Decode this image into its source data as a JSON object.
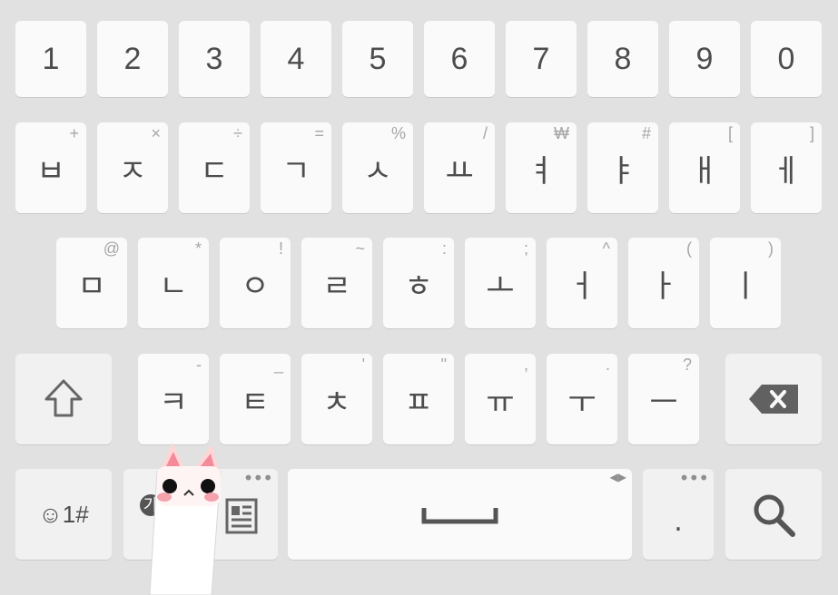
{
  "keyboard": {
    "number_row": [
      "1",
      "2",
      "3",
      "4",
      "5",
      "6",
      "7",
      "8",
      "9",
      "0"
    ],
    "row1": [
      {
        "label": "ㅂ",
        "hint": "+"
      },
      {
        "label": "ㅈ",
        "hint": "×"
      },
      {
        "label": "ㄷ",
        "hint": "÷"
      },
      {
        "label": "ㄱ",
        "hint": "="
      },
      {
        "label": "ㅅ",
        "hint": "%"
      },
      {
        "label": "ㅛ",
        "hint": "/"
      },
      {
        "label": "ㅕ",
        "hint": "₩"
      },
      {
        "label": "ㅑ",
        "hint": "#"
      },
      {
        "label": "ㅐ",
        "hint": "["
      },
      {
        "label": "ㅔ",
        "hint": "]"
      }
    ],
    "row2": [
      {
        "label": "ㅁ",
        "hint": "@"
      },
      {
        "label": "ㄴ",
        "hint": "*"
      },
      {
        "label": "ㅇ",
        "hint": "!"
      },
      {
        "label": "ㄹ",
        "hint": "~"
      },
      {
        "label": "ㅎ",
        "hint": ":"
      },
      {
        "label": "ㅗ",
        "hint": ";"
      },
      {
        "label": "ㅓ",
        "hint": "^"
      },
      {
        "label": "ㅏ",
        "hint": "("
      },
      {
        "label": "ㅣ",
        "hint": ")"
      }
    ],
    "row3": [
      {
        "label": "ㅋ",
        "hint": "-"
      },
      {
        "label": "ㅌ",
        "hint": "_"
      },
      {
        "label": "ㅊ",
        "hint": "'"
      },
      {
        "label": "ㅍ",
        "hint": "\""
      },
      {
        "label": "ㅠ",
        "hint": ","
      },
      {
        "label": "ㅜ",
        "hint": "."
      },
      {
        "label": "ㅡ",
        "hint": "?"
      }
    ],
    "bottom": {
      "symbols_label": "☺1#",
      "lang_label": "가",
      "more_dots": "•••",
      "period_label": ".",
      "space_arrows": "◀▶"
    },
    "icons": {
      "shift": "shift-icon",
      "backspace": "backspace-icon",
      "search": "search-icon",
      "document": "document-icon",
      "space": "space-bar-icon"
    },
    "colors": {
      "background": "#e1e1e1",
      "key": "#fafafa",
      "text": "#4d4d4d",
      "hint": "#a6a6a6"
    }
  }
}
